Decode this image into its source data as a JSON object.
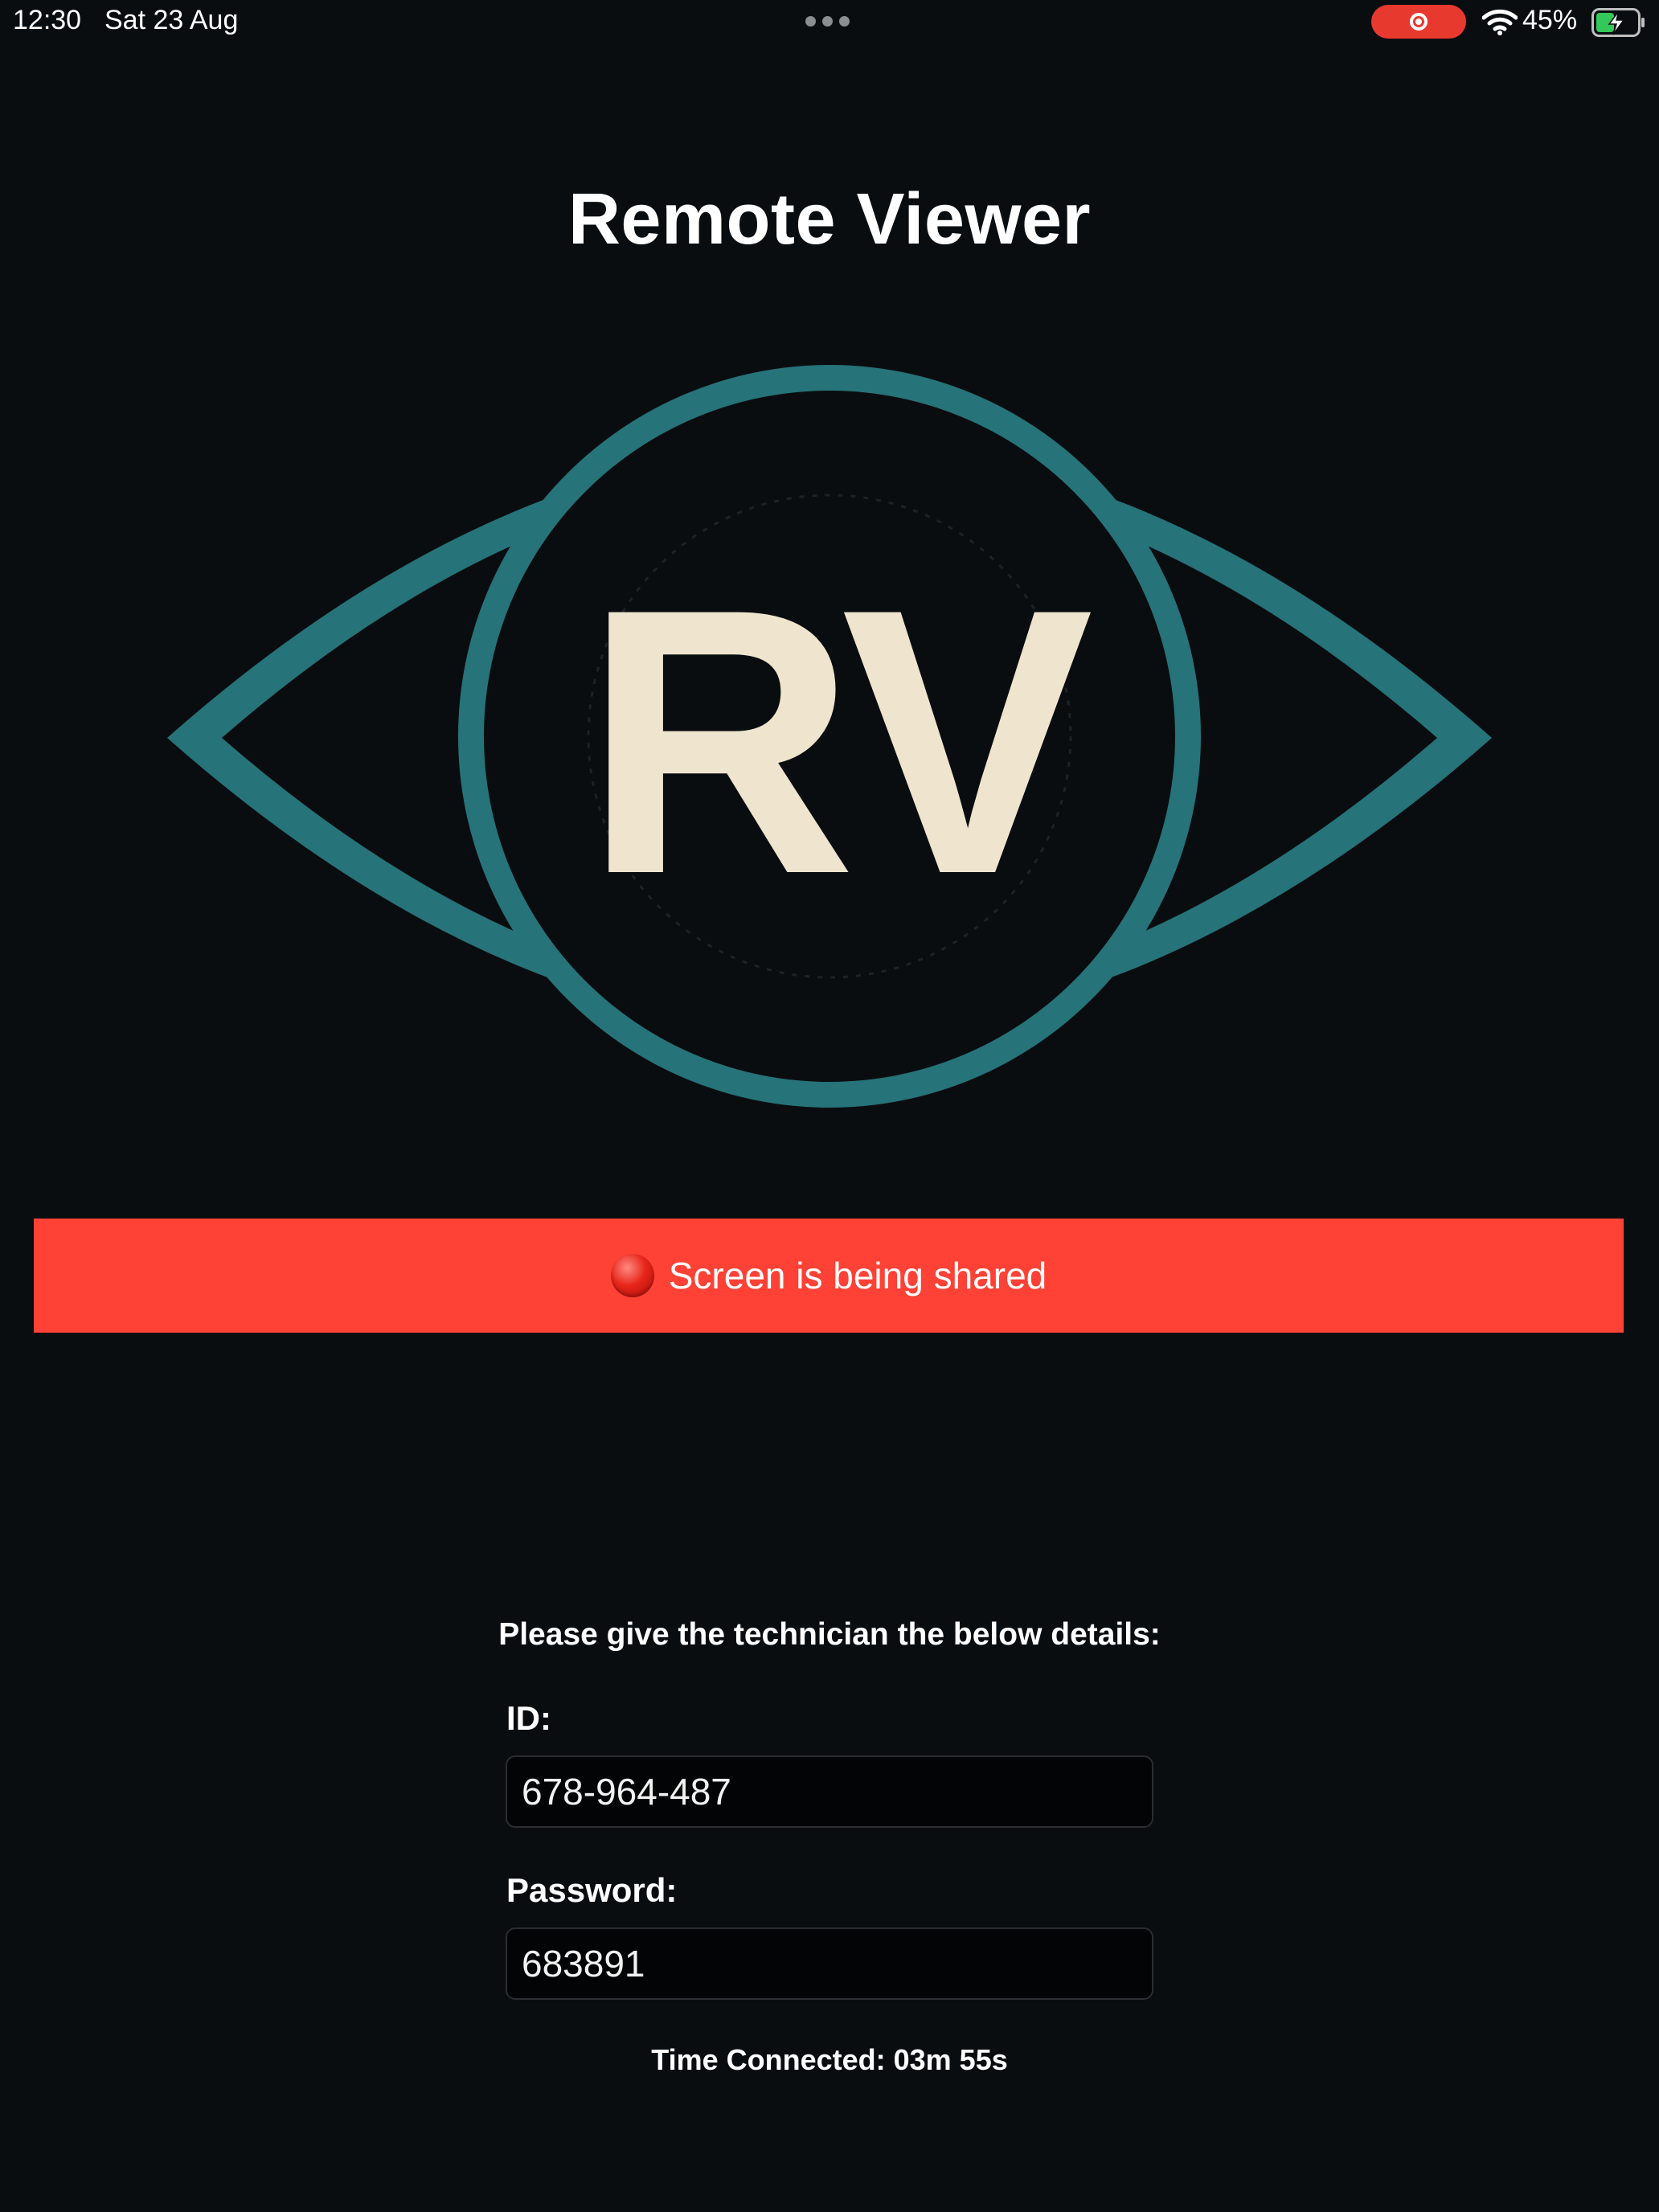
{
  "status_bar": {
    "time": "12:30",
    "date": "Sat 23 Aug",
    "battery_percent": "45%",
    "battery_level": 0.45,
    "icons": [
      "more-dots-icon",
      "screen-recording-icon",
      "wifi-icon",
      "battery-charging-icon"
    ]
  },
  "app": {
    "title": "Remote Viewer",
    "logo_text": "RV"
  },
  "banner": {
    "text": "Screen is being shared",
    "icon": "red-circle-icon",
    "color": "#ff4136"
  },
  "details": {
    "instructions": "Please give the technician the below details:",
    "id_label": "ID:",
    "id_value": "678-964-487",
    "password_label": "Password:",
    "password_value": "683891",
    "time_connected": "Time Connected: 03m 55s"
  },
  "colors": {
    "background": "#0a0d10",
    "logo_teal": "#267379",
    "logo_letters": "#efe5cf"
  }
}
